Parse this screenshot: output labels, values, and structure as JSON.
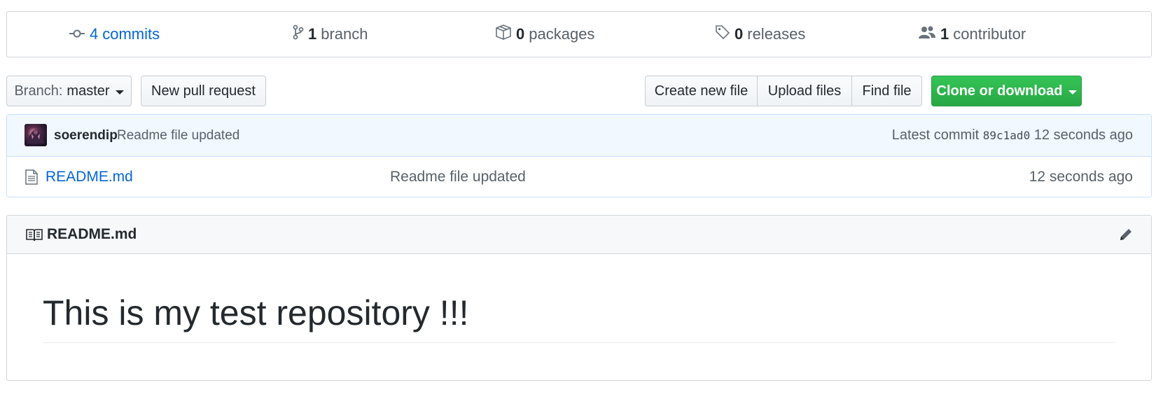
{
  "summary": {
    "commits": {
      "count": "4",
      "label": "commits",
      "icon": "commit-icon"
    },
    "branches": {
      "count": "1",
      "label": "branch",
      "icon": "branch-icon"
    },
    "packages": {
      "count": "0",
      "label": "packages",
      "icon": "package-icon"
    },
    "releases": {
      "count": "0",
      "label": "releases",
      "icon": "tag-icon"
    },
    "contributors": {
      "count": "1",
      "label": "contributor",
      "icon": "people-icon"
    }
  },
  "toolbar": {
    "branch_prefix": "Branch:",
    "branch_name": "master",
    "new_pr": "New pull request",
    "create_file": "Create new file",
    "upload_files": "Upload files",
    "find_file": "Find file",
    "clone": "Clone or download"
  },
  "commit": {
    "author": "soerendip",
    "message": "Readme file updated",
    "latest_label": "Latest commit",
    "sha": "89c1ad0",
    "age": "12 seconds ago"
  },
  "files": [
    {
      "name": "README.md",
      "message": "Readme file updated",
      "age": "12 seconds ago"
    }
  ],
  "readme": {
    "title": "README.md",
    "heading": "This is my test repository !!!"
  },
  "colors": {
    "link": "#0366d6",
    "primary": "#28a745",
    "commit_bar_bg": "#f1f8ff"
  }
}
